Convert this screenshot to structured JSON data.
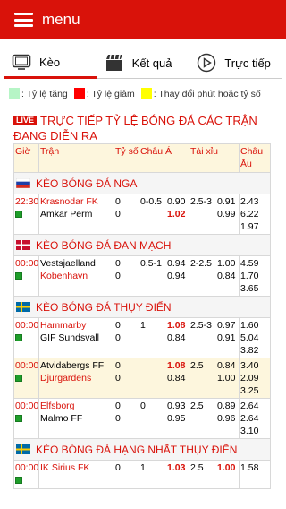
{
  "header": {
    "title": "menu"
  },
  "tabs": [
    {
      "label": "Kèo",
      "icon": "tv-icon",
      "active": true
    },
    {
      "label": "Kết quả",
      "icon": "clapperboard-icon",
      "active": false
    },
    {
      "label": "Trực tiếp",
      "icon": "play-icon",
      "active": false
    }
  ],
  "legend": [
    {
      "text": ": Tỷ lệ tăng",
      "color": "#b6f5c6"
    },
    {
      "text": ": Tỷ lệ giảm",
      "color": "#ff0000"
    },
    {
      "text": ": Thay đổi phút hoặc tỷ số",
      "color": "#ffff00"
    }
  ],
  "live": {
    "badge": "LIVE",
    "title": "TRỰC TIẾP TỶ LỆ BÓNG ĐÁ CÁC TRẬN ĐANG DIỄN RA"
  },
  "columns": [
    "Giờ",
    "Trận",
    "Tỷ số",
    "Châu Á",
    "Tài xỉu",
    "Châu Âu"
  ],
  "leagues": [
    {
      "name": "KÈO BÓNG ĐÁ NGA",
      "flag": "russia",
      "matches": [
        {
          "time": "22:30",
          "home": "Krasnodar FK",
          "away": "Amkar Perm",
          "score_home": "0",
          "score_away": "0",
          "asia_line": "0-0.5",
          "asia_home": "0.90",
          "asia_away": "1.02",
          "ou_line": "2.5-3",
          "ou_over": "0.91",
          "ou_under": "0.99",
          "eu": [
            "2.43",
            "6.22",
            "1.97"
          ],
          "home_red": true,
          "away_red": false,
          "asia_home_red": false,
          "asia_away_red": true,
          "asia_away_bold": true
        }
      ]
    },
    {
      "name": "KÈO BÓNG ĐÁ ĐAN MẠCH",
      "flag": "denmark",
      "matches": [
        {
          "time": "00:00",
          "home": "Vestsjaelland",
          "away": "Kobenhavn",
          "score_home": "0",
          "score_away": "0",
          "asia_line": "0.5-1",
          "asia_home": "0.94",
          "asia_away": "0.94",
          "ou_line": "2-2.5",
          "ou_over": "1.00",
          "ou_under": "0.84",
          "eu": [
            "4.59",
            "1.70",
            "3.65"
          ],
          "home_red": false,
          "away_red": true,
          "asia_home_red": false,
          "asia_away_red": false,
          "asia_away_bold": false
        }
      ]
    },
    {
      "name": "KÈO BÓNG ĐÁ THỤY ĐIỂN",
      "flag": "sweden",
      "matches": [
        {
          "time": "00:00",
          "home": "Hammarby",
          "away": "GIF Sundsvall",
          "score_home": "0",
          "score_away": "0",
          "asia_line": "1",
          "asia_home": "1.08",
          "asia_away": "0.84",
          "ou_line": "2.5-3",
          "ou_over": "0.97",
          "ou_under": "0.91",
          "eu": [
            "1.60",
            "5.04",
            "3.82"
          ],
          "home_red": true,
          "away_red": false,
          "asia_home_red": true,
          "asia_away_red": false,
          "asia_away_bold": false,
          "asia_home_bold": true
        },
        {
          "time": "00:00",
          "home": "Atvidabergs FF",
          "away": "Djurgardens",
          "score_home": "0",
          "score_away": "0",
          "asia_line": "",
          "asia_home": "1.08",
          "asia_away": "0.84",
          "ou_line": "2.5",
          "ou_over": "0.84",
          "ou_under": "1.00",
          "eu": [
            "3.40",
            "2.09",
            "3.25"
          ],
          "home_red": false,
          "away_red": true,
          "asia_home_red": true,
          "asia_away_red": false,
          "asia_away_bold": false,
          "asia_home_bold": true,
          "alt": true
        },
        {
          "time": "00:00",
          "home": "Elfsborg",
          "away": "Malmo FF",
          "score_home": "0",
          "score_away": "0",
          "asia_line": "0",
          "asia_home": "0.93",
          "asia_away": "0.95",
          "ou_line": "2.5",
          "ou_over": "0.89",
          "ou_under": "0.96",
          "eu": [
            "2.64",
            "2.64",
            "3.10"
          ],
          "home_red": true,
          "away_red": false,
          "asia_home_red": false,
          "asia_away_red": false,
          "asia_away_bold": false
        }
      ]
    },
    {
      "name": "KÈO BÓNG ĐÁ HẠNG NHẤT THỤY ĐIỂN",
      "flag": "sweden",
      "matches": [
        {
          "time": "00:00",
          "home": "IK Sirius FK",
          "away": "",
          "score_home": "0",
          "score_away": "",
          "asia_line": "1",
          "asia_home": "1.03",
          "asia_away": "",
          "ou_line": "2.5",
          "ou_over": "1.00",
          "ou_under": "",
          "eu": [
            "1.58",
            "",
            ""
          ],
          "home_red": true,
          "away_red": false,
          "asia_home_red": true,
          "asia_home_bold": true,
          "ou_over_red": true
        }
      ]
    }
  ]
}
